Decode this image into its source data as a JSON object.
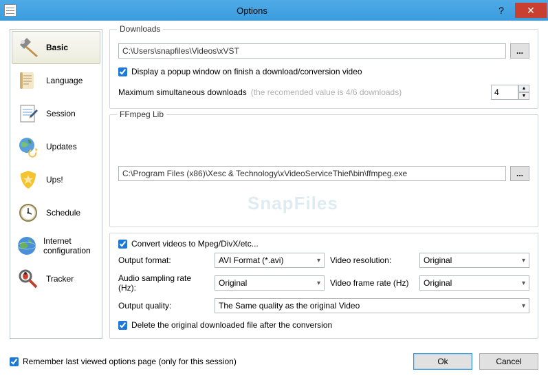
{
  "window": {
    "title": "Options"
  },
  "sidebar": {
    "items": [
      {
        "label": "Basic"
      },
      {
        "label": "Language"
      },
      {
        "label": "Session"
      },
      {
        "label": "Updates"
      },
      {
        "label": "Ups!"
      },
      {
        "label": "Schedule"
      },
      {
        "label": "Internet configuration"
      },
      {
        "label": "Tracker"
      }
    ]
  },
  "downloads": {
    "legend": "Downloads",
    "path": "C:\\Users\\snapfiles\\Videos\\xVST",
    "popupLabel": "Display a popup window on finish a download/conversion video",
    "maxLabel": "Maximum simultaneous downloads",
    "maxHint": "(the recomended value is 4/6 downloads)",
    "maxValue": "4"
  },
  "ffmpeg": {
    "legend": "FFmpeg Lib",
    "path": "C:\\Program Files (x86)\\Xesc & Technology\\xVideoServiceThief\\bin\\ffmpeg.exe"
  },
  "convert": {
    "enableLabel": "Convert videos to Mpeg/DivX/etc...",
    "outputFormatLabel": "Output format:",
    "outputFormatValue": "AVI Format (*.avi)",
    "videoResolutionLabel": "Video resolution:",
    "videoResolutionValue": "Original",
    "audioRateLabel": "Audio sampling rate (Hz):",
    "audioRateValue": "Original",
    "frameRateLabel": "Video frame rate (Hz)",
    "frameRateValue": "Original",
    "outputQualityLabel": "Output quality:",
    "outputQualityValue": "The Same quality as the original Video",
    "deleteLabel": "Delete the original downloaded file after the conversion"
  },
  "footer": {
    "rememberLabel": "Remember last viewed options page (only for this session)",
    "okLabel": "Ok",
    "cancelLabel": "Cancel"
  },
  "watermark": "SnapFiles"
}
